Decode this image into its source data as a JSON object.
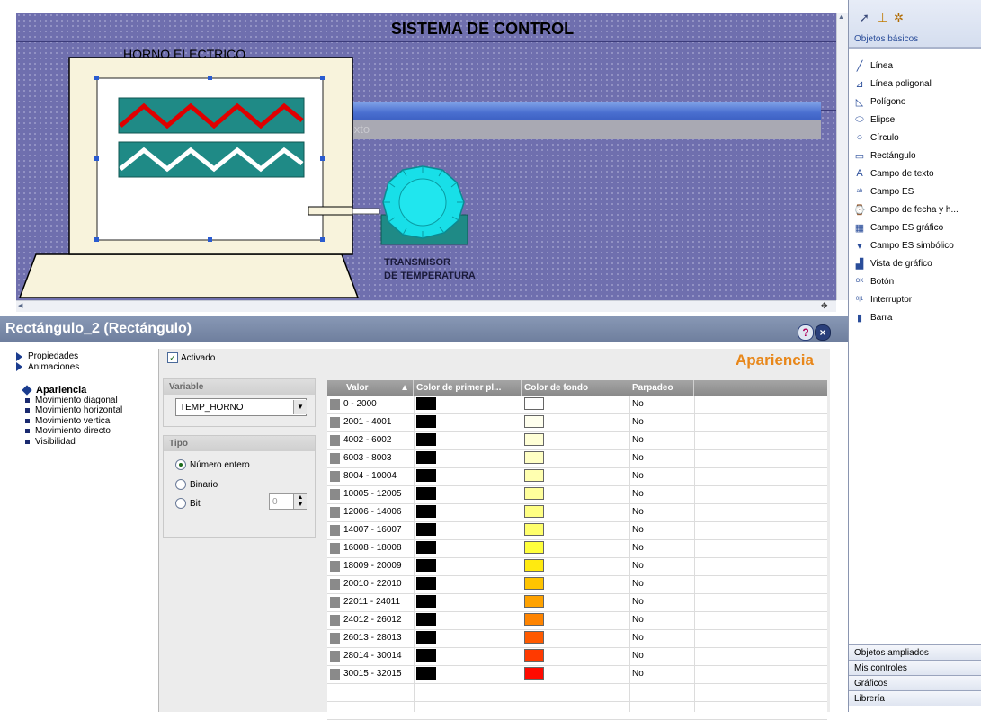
{
  "hmi": {
    "title": "SISTEMA DE CONTROL",
    "oven_label": "HORNO ELECTRICO",
    "texto_placeholder": "Texto",
    "transmitter_line1": "TRANSMISOR",
    "transmitter_line2": "DE TEMPERATURA"
  },
  "toolbox": {
    "section_title": "Objetos básicos",
    "items": [
      {
        "label": "Línea",
        "icon": "line-icon"
      },
      {
        "label": "Línea poligonal",
        "icon": "polyline-icon"
      },
      {
        "label": "Polígono",
        "icon": "polygon-icon"
      },
      {
        "label": "Elipse",
        "icon": "ellipse-icon"
      },
      {
        "label": "Círculo",
        "icon": "circle-icon"
      },
      {
        "label": "Rectángulo",
        "icon": "rectangle-icon"
      },
      {
        "label": "Campo de texto",
        "icon": "text-field-icon"
      },
      {
        "label": "Campo ES",
        "icon": "io-field-icon"
      },
      {
        "label": "Campo de fecha y h...",
        "icon": "date-time-field-icon"
      },
      {
        "label": "Campo ES gráfico",
        "icon": "graphic-io-field-icon"
      },
      {
        "label": "Campo ES simbólico",
        "icon": "symbolic-io-field-icon"
      },
      {
        "label": "Vista de gráfico",
        "icon": "graphic-view-icon"
      },
      {
        "label": "Botón",
        "icon": "button-icon"
      },
      {
        "label": "Interruptor",
        "icon": "switch-icon"
      },
      {
        "label": "Barra",
        "icon": "bar-icon"
      }
    ],
    "bottom_sections": [
      "Objetos ampliados",
      "Mis controles",
      "Gráficos",
      "Librería"
    ]
  },
  "panel": {
    "title": "Rectángulo_2 (Rectángulo)",
    "help_symbol": "?",
    "close_symbol": "×",
    "section_heading": "Apariencia",
    "activado_label": "Activado",
    "nav": [
      {
        "label": "Propiedades",
        "kind": "group"
      },
      {
        "label": "Animaciones",
        "kind": "group"
      },
      {
        "label": "Apariencia",
        "kind": "selected"
      },
      {
        "label": "Movimiento diagonal",
        "kind": "item"
      },
      {
        "label": "Movimiento horizontal",
        "kind": "item"
      },
      {
        "label": "Movimiento vertical",
        "kind": "item"
      },
      {
        "label": "Movimiento directo",
        "kind": "item"
      },
      {
        "label": "Visibilidad",
        "kind": "item"
      }
    ],
    "variable_heading": "Variable",
    "variable_value": "TEMP_HORNO",
    "tipo_heading": "Tipo",
    "tipo_options": [
      {
        "label": "Número entero",
        "selected": true
      },
      {
        "label": "Binario",
        "selected": false
      },
      {
        "label": "Bit",
        "selected": false
      }
    ],
    "bit_value": "0",
    "table": {
      "columns": [
        "Valor",
        "Color de primer pl...",
        "Color de fondo",
        "Parpadeo"
      ],
      "rows": [
        {
          "valor": "0 - 2000",
          "fg": "#000000",
          "bg": "#ffffff",
          "blink": "No"
        },
        {
          "valor": "2001 - 4001",
          "fg": "#000000",
          "bg": "#ffffee",
          "blink": "No"
        },
        {
          "valor": "4002 - 6002",
          "fg": "#000000",
          "bg": "#ffffd6",
          "blink": "No"
        },
        {
          "valor": "6003 - 8003",
          "fg": "#000000",
          "bg": "#ffffc4",
          "blink": "No"
        },
        {
          "valor": "8004 - 10004",
          "fg": "#000000",
          "bg": "#ffffb0",
          "blink": "No"
        },
        {
          "valor": "10005 - 12005",
          "fg": "#000000",
          "bg": "#ffff9c",
          "blink": "No"
        },
        {
          "valor": "12006 - 14006",
          "fg": "#000000",
          "bg": "#ffff84",
          "blink": "No"
        },
        {
          "valor": "14007 - 16007",
          "fg": "#000000",
          "bg": "#ffff6c",
          "blink": "No"
        },
        {
          "valor": "16008 - 18008",
          "fg": "#000000",
          "bg": "#ffff3c",
          "blink": "No"
        },
        {
          "valor": "18009 - 20009",
          "fg": "#000000",
          "bg": "#ffea10",
          "blink": "No"
        },
        {
          "valor": "20010 - 22010",
          "fg": "#000000",
          "bg": "#ffc400",
          "blink": "No"
        },
        {
          "valor": "22011 - 24011",
          "fg": "#000000",
          "bg": "#ffa200",
          "blink": "No"
        },
        {
          "valor": "24012 - 26012",
          "fg": "#000000",
          "bg": "#ff8400",
          "blink": "No"
        },
        {
          "valor": "26013 - 28013",
          "fg": "#000000",
          "bg": "#ff5a00",
          "blink": "No"
        },
        {
          "valor": "28014 - 30014",
          "fg": "#000000",
          "bg": "#ff3a00",
          "blink": "No"
        },
        {
          "valor": "30015 - 32015",
          "fg": "#000000",
          "bg": "#ff0a00",
          "blink": "No"
        }
      ]
    }
  },
  "colors": {
    "hmi_background": "#6f6fae",
    "accent": "#e8871a",
    "oven_fill": "#f8f3dc",
    "band_fill": "#1f8a86",
    "red_wave": "#e00000",
    "white_wave": "#ffffff",
    "transmitter": "#18dfe8"
  }
}
